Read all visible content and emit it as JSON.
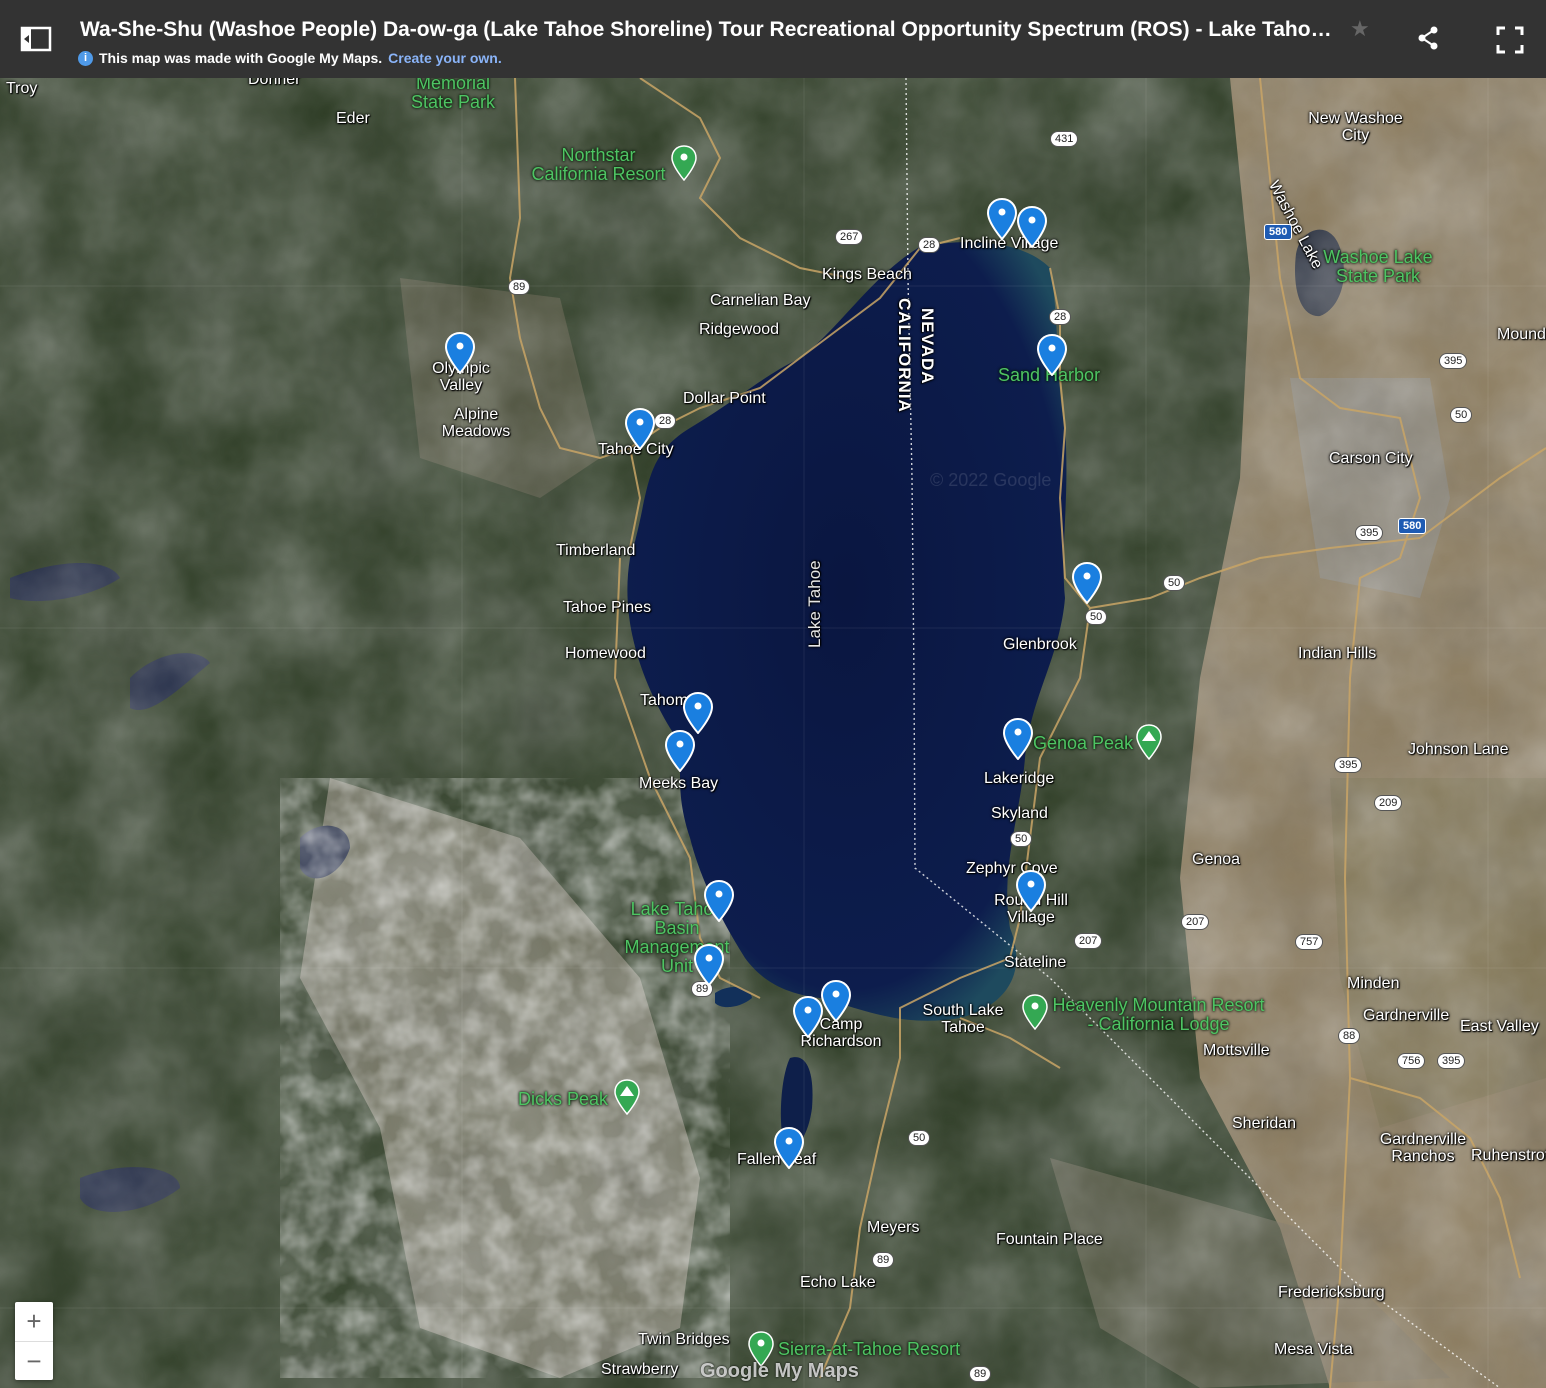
{
  "header": {
    "title": "Wa-She-Shu (Washoe People) Da-ow-ga (Lake Tahoe Shoreline) Tour Recreational Opportunity Spectrum (ROS) - Lake Tahoe Shore...",
    "made_with": "This map was made with Google My Maps.",
    "create_link": "Create your own."
  },
  "map": {
    "lake_label": "Lake Tahoe",
    "state_labels": {
      "nevada": "NEVADA",
      "california": "CALIFORNIA"
    },
    "place_labels": [
      "Troy",
      "Donner",
      "Memorial State Park",
      "Eder",
      "Northstar California Resort",
      "Incline Village",
      "Kings Beach",
      "Carnelian Bay",
      "Ridgewood",
      "Olympic Valley",
      "Alpine Meadows",
      "Dollar Point",
      "Tahoe City",
      "Sand Harbor",
      "New Washoe City",
      "Washoe Lake",
      "Washoe Lake State Park",
      "Mound",
      "Carson City",
      "Timberland",
      "Tahoe Pines",
      "Homewood",
      "Tahoma",
      "Glenbrook",
      "Indian Hills",
      "Genoa Peak",
      "Meeks Bay",
      "Lakeridge",
      "Johnson Lane",
      "Skyland",
      "Zephyr Cove",
      "Genoa",
      "Round Hill Village",
      "Lake Tahoe Basin Management Unit",
      "Stateline",
      "Minden",
      "Heavenly Mountain Resort - California Lodge",
      "South Lake Tahoe",
      "Camp Richardson",
      "Gardnerville",
      "East Valley",
      "Mottsville",
      "Dicks Peak",
      "Sheridan",
      "Gardnerville Ranchos",
      "Ruhenstroth",
      "Fallen Leaf",
      "Meyers",
      "Fountain Place",
      "Echo Lake",
      "Fredericksburg",
      "Twin Bridges",
      "Sierra-at-Tahoe Resort",
      "Strawberry",
      "Mesa Vista"
    ],
    "route_shields": [
      "431",
      "267",
      "28",
      "89",
      "580",
      "50",
      "395",
      "209",
      "207",
      "757",
      "88",
      "756"
    ],
    "zoom": {
      "in": "+",
      "out": "−"
    },
    "watermark": "Google My Maps",
    "copyright": "© 2022 Google"
  },
  "colors": {
    "header_bg": "#333333",
    "lake": "#0b1a45",
    "marker": "#1a7fe0",
    "green_label": "#4ec463"
  },
  "icons": [
    "sidebar-toggle-icon",
    "star-icon",
    "share-icon",
    "fullscreen-icon",
    "info-icon",
    "location-pin-icon",
    "mountain-pin-icon",
    "ski-pin-icon"
  ]
}
